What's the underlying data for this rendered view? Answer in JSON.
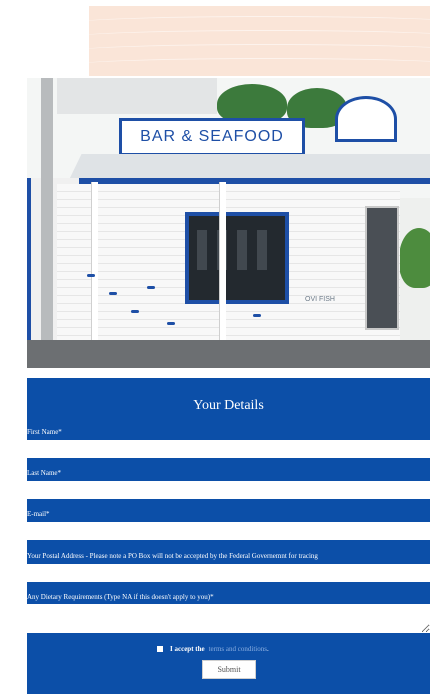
{
  "photo": {
    "sign_text": "BAR & SEAFOOD",
    "logo_text": "OVI FISH"
  },
  "form": {
    "title": "Your Details",
    "fields": {
      "first_name": {
        "label": "First Name*",
        "value": ""
      },
      "last_name": {
        "label": "Last Name*",
        "value": ""
      },
      "email": {
        "label": "E-mail*",
        "value": ""
      },
      "postal": {
        "label": "Your Postal Address - Please note a PO Box will not be accepted by the Federal Governemnt for tracing",
        "value": ""
      },
      "dietary": {
        "label": "Any Dietary Requirements (Type NA if this doesn't apply to you)*",
        "value": ""
      }
    },
    "accept": {
      "prefix": "I accept the",
      "link": "terms and conditions",
      "suffix": "."
    },
    "submit_label": "Submit"
  },
  "colors": {
    "brand_blue": "#0c4fa8",
    "peach": "#fae5d8"
  }
}
